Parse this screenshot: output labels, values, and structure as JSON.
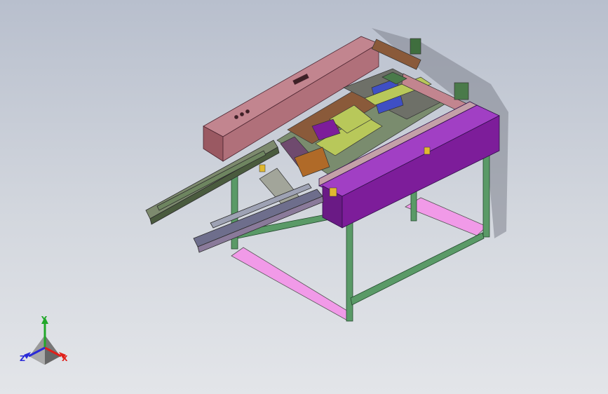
{
  "viewport": {
    "background_top": "#b8bfcd",
    "background_bottom": "#e3e5e9"
  },
  "model": {
    "colors": {
      "top_frame": "#b0707a",
      "cover": "#7d1d9a",
      "frame": "#5a9a67",
      "base_plate": "#f19ae8",
      "belt": "#7d8a6e",
      "block": "#3f4fc4",
      "rail": "#b8c85a",
      "plate": "#8a5a3a"
    }
  },
  "triad": {
    "x_label": "X",
    "y_label": "Y",
    "z_label": "Z",
    "x_color": "#e0201a",
    "y_color": "#22a82a",
    "z_color": "#2a2ad8"
  }
}
